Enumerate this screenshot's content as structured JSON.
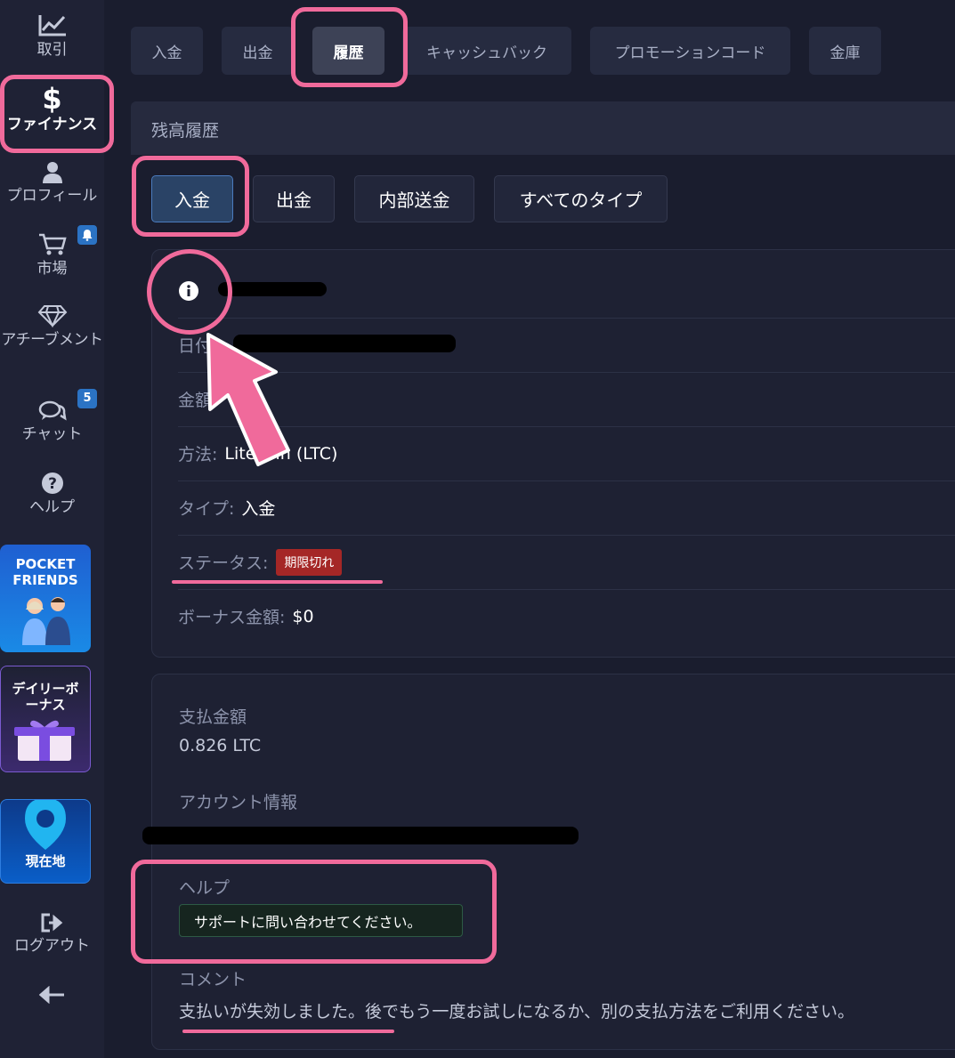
{
  "sidebar": {
    "items": [
      {
        "label": "取引",
        "icon": "chart-line-icon"
      },
      {
        "label": "ファイナンス",
        "icon": "dollar-icon"
      },
      {
        "label": "プロフィール",
        "icon": "user-icon"
      },
      {
        "label": "市場",
        "icon": "cart-icon"
      },
      {
        "label": "アチーブメント",
        "icon": "diamond-icon"
      },
      {
        "label": "チャット",
        "icon": "chat-icon"
      },
      {
        "label": "ヘルプ",
        "icon": "question-icon"
      }
    ],
    "market_badge_icon": "bell-icon",
    "chat_badge": "5",
    "promos": {
      "pocket_friends": "POCKET FRIENDS",
      "daily_bonus": "デイリーボーナス",
      "location": "現在地"
    },
    "logout": "ログアウト",
    "collapse_icon": "arrow-left-icon"
  },
  "tabs": [
    "入金",
    "出金",
    "履歴",
    "キャッシュバック",
    "プロモーションコード",
    "金庫"
  ],
  "active_tab": "履歴",
  "section_title": "残高履歴",
  "filters": [
    "入金",
    "出金",
    "内部送金",
    "すべてのタイプ"
  ],
  "active_filter": "入金",
  "transaction": {
    "date_label": "日付:",
    "amount_label": "金額:",
    "method_label": "方法:",
    "method_value": "Litecoin (LTC)",
    "type_label": "タイプ:",
    "type_value": "入金",
    "status_label": "ステータス:",
    "status_value": "期限切れ",
    "bonus_label": "ボーナス金額:",
    "bonus_value": "$0"
  },
  "details": {
    "payment_label": "支払金額",
    "payment_value": "0.826 LTC",
    "account_label": "アカウント情報",
    "help_label": "ヘルプ",
    "help_text": "サポートに問い合わせてください。",
    "comment_label": "コメント",
    "comment_text": "支払いが失効しました。後でもう一度お試しになるか、別の支払方法をご利用ください。"
  },
  "colors": {
    "annotation": "#f06a9b",
    "status_expired": "#a52726",
    "active_filter": "#2a4366"
  }
}
